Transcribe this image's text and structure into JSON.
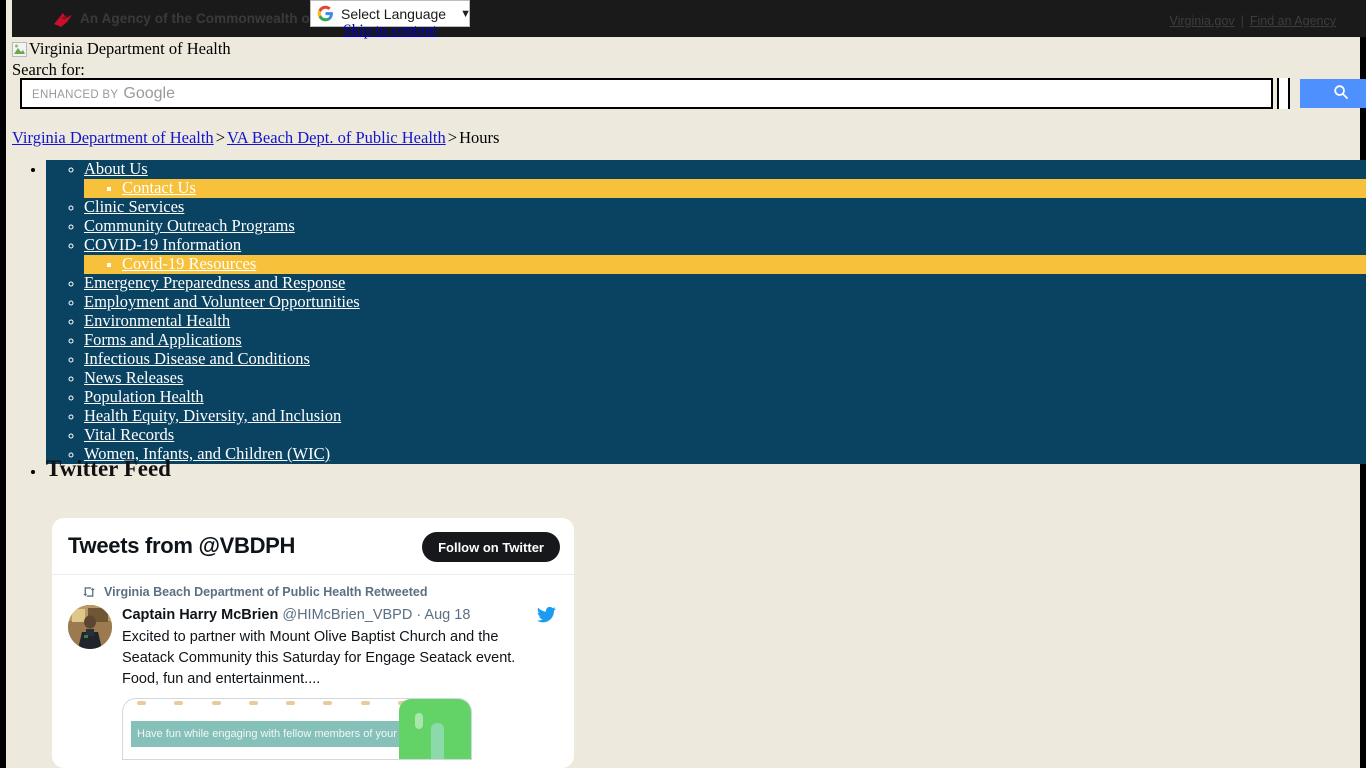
{
  "gov_bar": {
    "agency_text": "An Agency of the Commonwealth of Virginia",
    "cardinal_icon": "cardinal-bird-icon",
    "links": [
      {
        "label": "Virginia.gov"
      },
      {
        "label": "Find an Agency"
      }
    ],
    "separator": "|"
  },
  "translate": {
    "logo_icon": "google-g-icon",
    "label": "Select Language",
    "caret": "▼"
  },
  "skip_link": {
    "label": "Skip to content"
  },
  "site": {
    "logo_alt": "Virginia Department of Health",
    "broken_image_icon": "broken-image-icon"
  },
  "search": {
    "label": "Search for:",
    "placeholder_small": "ENHANCED BY",
    "placeholder_brand": "Google",
    "value": "",
    "button_icon": "search-magnifier-icon",
    "button_color": "#4d90fe"
  },
  "breadcrumb": {
    "items": [
      {
        "label": "Virginia Department of Health",
        "link": true
      },
      {
        "label": "VA Beach Dept. of Public Health",
        "link": true
      },
      {
        "label": "Hours",
        "link": false
      }
    ],
    "separator": ">"
  },
  "nav": {
    "background": "#0a4261",
    "highlight": "#f7c13c",
    "items": [
      {
        "label": "About Us",
        "children": [
          {
            "label": "Contact Us"
          }
        ]
      },
      {
        "label": "Clinic Services",
        "children": []
      },
      {
        "label": "Community Outreach Programs",
        "children": []
      },
      {
        "label": "COVID-19 Information",
        "children": [
          {
            "label": "Covid-19 Resources"
          }
        ]
      },
      {
        "label": "Emergency Preparedness and Response",
        "children": []
      },
      {
        "label": "Employment and Volunteer Opportunities",
        "children": []
      },
      {
        "label": "Environmental Health",
        "children": []
      },
      {
        "label": "Forms and Applications",
        "children": []
      },
      {
        "label": "Infectious Disease and Conditions",
        "children": []
      },
      {
        "label": "News Releases",
        "children": []
      },
      {
        "label": "Population Health",
        "children": []
      },
      {
        "label": "Health Equity, Diversity, and Inclusion",
        "children": []
      },
      {
        "label": "Vital Records",
        "children": []
      },
      {
        "label": "Women, Infants, and Children (WIC)",
        "children": []
      }
    ]
  },
  "feed": {
    "heading": "Twitter Feed",
    "widget": {
      "title": "Tweets from @VBDPH",
      "follow_button": "Follow on Twitter",
      "retweet_icon": "retweet-icon",
      "retweet_notice": "Virginia Beach Department of Public Health Retweeted",
      "bird_icon": "twitter-bird-icon",
      "avatar": "tweet-author-avatar",
      "tweet": {
        "author": "Captain Harry McBrien",
        "handle": "@HIMcBrien_VBPD",
        "date_sep": "·",
        "date": "Aug 18",
        "text": "Excited to partner with Mount Olive Baptist Church and the Seatack Community this Saturday for Engage Seatack event. Food, fun and entertainment....",
        "media_caption": "Have fun while engaging with fellow members of your community"
      }
    }
  }
}
